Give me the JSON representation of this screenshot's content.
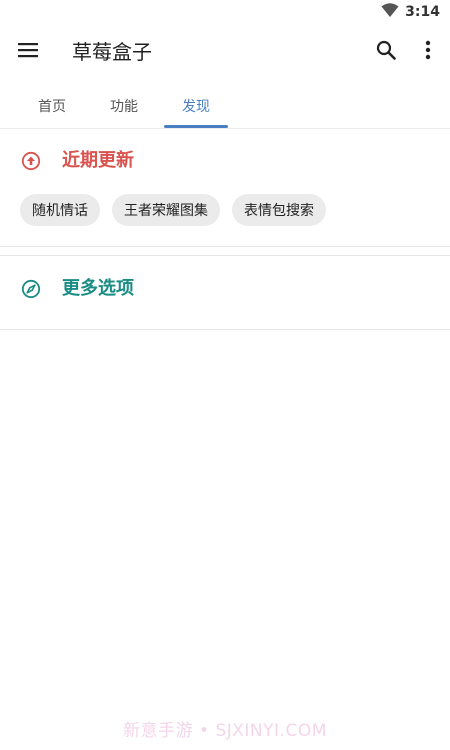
{
  "status_bar": {
    "time": "3:14",
    "wifi_icon": "wifi-icon"
  },
  "app_bar": {
    "title": "草莓盒子",
    "menu_icon": "menu-icon",
    "search_icon": "search-icon",
    "more_icon": "more-vert-icon"
  },
  "tabs": [
    {
      "label": "首页",
      "selected": false
    },
    {
      "label": "功能",
      "selected": false
    },
    {
      "label": "发现",
      "selected": true
    }
  ],
  "accent_color": "#4a7fc1",
  "recent": {
    "title": "近期更新",
    "icon": "arrow-up-circle-icon",
    "color": "#d9534f",
    "chips": [
      "随机情话",
      "王者荣耀图集",
      "表情包搜索"
    ]
  },
  "more_options": {
    "title": "更多选项",
    "icon": "compass-icon",
    "color": "#1a8c86"
  },
  "watermark": "新意手游 • SJXINYI.COM"
}
